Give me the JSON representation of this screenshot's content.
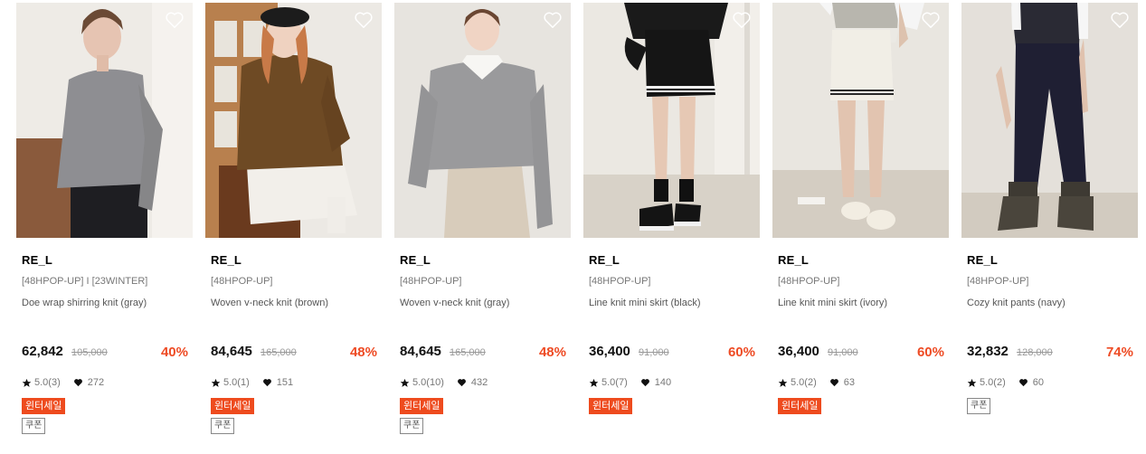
{
  "products": [
    {
      "brand": "RE_L",
      "tags": "[48HPOP-UP] I [23WINTER]",
      "name": "Doe wrap shirring knit (gray)",
      "price": "62,842",
      "original_price": "105,000",
      "discount": "40%",
      "rating": "5.0(3)",
      "likes": "272",
      "sale_badge": "윈터세일",
      "coupon_badge": "쿠폰"
    },
    {
      "brand": "RE_L",
      "tags": "[48HPOP-UP]",
      "name": "Woven v-neck knit (brown)",
      "price": "84,645",
      "original_price": "165,000",
      "discount": "48%",
      "rating": "5.0(1)",
      "likes": "151",
      "sale_badge": "윈터세일",
      "coupon_badge": "쿠폰"
    },
    {
      "brand": "RE_L",
      "tags": "[48HPOP-UP]",
      "name": "Woven v-neck knit (gray)",
      "price": "84,645",
      "original_price": "165,000",
      "discount": "48%",
      "rating": "5.0(10)",
      "likes": "432",
      "sale_badge": "윈터세일",
      "coupon_badge": "쿠폰"
    },
    {
      "brand": "RE_L",
      "tags": "[48HPOP-UP]",
      "name": "Line knit mini skirt (black)",
      "price": "36,400",
      "original_price": "91,000",
      "discount": "60%",
      "rating": "5.0(7)",
      "likes": "140",
      "sale_badge": "윈터세일"
    },
    {
      "brand": "RE_L",
      "tags": "[48HPOP-UP]",
      "name": "Line knit mini skirt (ivory)",
      "price": "36,400",
      "original_price": "91,000",
      "discount": "60%",
      "rating": "5.0(2)",
      "likes": "63",
      "sale_badge": "윈터세일"
    },
    {
      "brand": "RE_L",
      "tags": "[48HPOP-UP]",
      "name": "Cozy knit pants (navy)",
      "price": "32,832",
      "original_price": "128,000",
      "discount": "74%",
      "rating": "5.0(2)",
      "likes": "60",
      "coupon_badge": "쿠폰"
    }
  ],
  "icons": {
    "wishlist": "heart-outline-icon",
    "star": "star-icon",
    "likes": "heart-icon"
  },
  "colors": {
    "discount": "#ee4b24",
    "sale_badge": "#ee4b1e"
  }
}
